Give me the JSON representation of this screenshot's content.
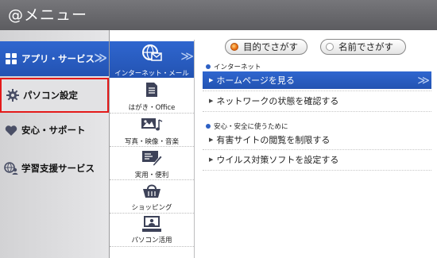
{
  "window": {
    "title": "@メニュー"
  },
  "sidebar": {
    "items": [
      {
        "label": "アプリ・サービス",
        "icon": "apps-grid-icon"
      },
      {
        "label": "パソコン設定",
        "icon": "gear-icon"
      },
      {
        "label": "安心・サポート",
        "icon": "heart-icon"
      },
      {
        "label": "学習支援サービス",
        "icon": "globe-person-icon"
      }
    ],
    "chevron": "≫"
  },
  "categories": {
    "items": [
      {
        "label": "インターネット・メール",
        "icon": "globe-mail-icon"
      },
      {
        "label": "はがき・Office",
        "icon": "document-icon"
      },
      {
        "label": "写真・映像・音楽",
        "icon": "photo-music-icon"
      },
      {
        "label": "実用・便利",
        "icon": "card-pen-icon"
      },
      {
        "label": "ショッピング",
        "icon": "basket-icon"
      },
      {
        "label": "パソコン活用",
        "icon": "computer-user-icon"
      }
    ],
    "chevron": "≫"
  },
  "search_mode": {
    "purpose": "目的でさがす",
    "name": "名前でさがす",
    "selected": "purpose"
  },
  "sections": [
    {
      "heading": "インターネット",
      "links": [
        "ホームページを見る",
        "ネットワークの状態を確認する"
      ]
    },
    {
      "heading": "安心・安全に使うために",
      "links": [
        "有害サイトの閲覧を制限する",
        "ウイルス対策ソフトを設定する"
      ]
    }
  ],
  "link_chevron": "≫",
  "link_bullet": "▶",
  "colors": {
    "accent": "#2a5cc0",
    "highlight_border": "#e41a1a",
    "titlebar": "#6a6a6e"
  }
}
